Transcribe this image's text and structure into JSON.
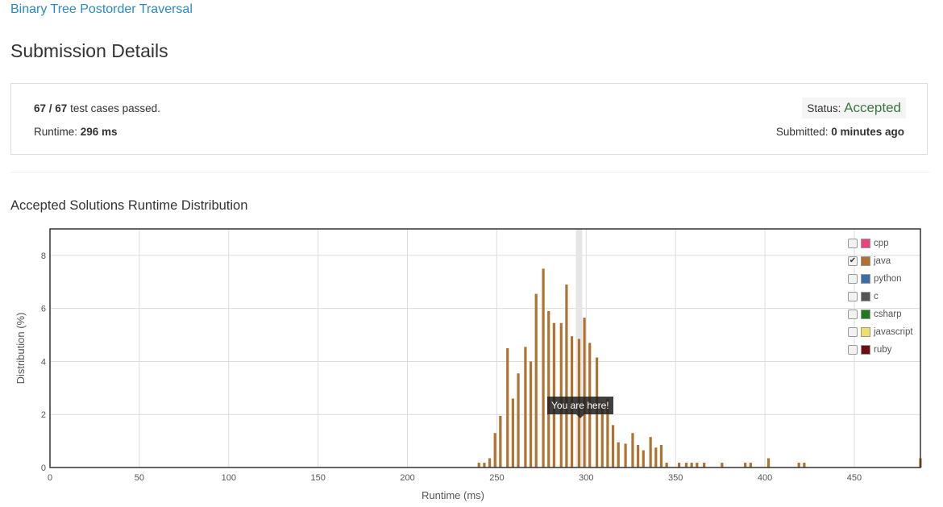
{
  "problem": {
    "title": "Binary Tree Postorder Traversal"
  },
  "page": {
    "title": "Submission Details"
  },
  "details": {
    "passed": "67",
    "sep": " / ",
    "total": "67",
    "passed_suffix": " test cases passed.",
    "runtime_label": "Runtime: ",
    "runtime_value": "296 ms",
    "status_label": "Status: ",
    "status_value": "Accepted",
    "submitted_label": "Submitted: ",
    "submitted_value": "0 minutes ago"
  },
  "colors": {
    "link": "#2a8ac6",
    "accepted": "#3a7a3f",
    "java_bar": "#b07230",
    "highlight": "#e6e6e6"
  },
  "legend": [
    {
      "label": "cpp",
      "color": "#e8457d",
      "checked": false
    },
    {
      "label": "java",
      "color": "#b07230",
      "checked": true
    },
    {
      "label": "python",
      "color": "#3b6da8",
      "checked": false
    },
    {
      "label": "c",
      "color": "#555555",
      "checked": false
    },
    {
      "label": "csharp",
      "color": "#1e7a1e",
      "checked": false
    },
    {
      "label": "javascript",
      "color": "#f0de6a",
      "checked": false
    },
    {
      "label": "ruby",
      "color": "#6b0f0f",
      "checked": false
    }
  ],
  "tooltip": {
    "text": "You are here!"
  },
  "chart_data": {
    "type": "bar",
    "title": "Accepted Solutions Runtime Distribution",
    "xlabel": "Runtime (ms)",
    "ylabel": "Distribution (%)",
    "xlim": [
      0,
      487
    ],
    "ylim": [
      0,
      9
    ],
    "xticks": [
      0,
      50,
      100,
      150,
      200,
      250,
      300,
      350,
      400,
      450
    ],
    "yticks": [
      0,
      2,
      4,
      6,
      8
    ],
    "grid": true,
    "legend_position": "top-right",
    "highlight_x": 296,
    "series": [
      {
        "name": "java",
        "points": [
          [
            240,
            0.18
          ],
          [
            243,
            0.18
          ],
          [
            246,
            0.35
          ],
          [
            249,
            1.3
          ],
          [
            252,
            1.95
          ],
          [
            256,
            4.5
          ],
          [
            259,
            2.6
          ],
          [
            262,
            3.55
          ],
          [
            266,
            4.55
          ],
          [
            269,
            4.0
          ],
          [
            272,
            6.55
          ],
          [
            276,
            7.5
          ],
          [
            279,
            5.9
          ],
          [
            282,
            5.45
          ],
          [
            286,
            5.45
          ],
          [
            289,
            6.9
          ],
          [
            292,
            4.95
          ],
          [
            296,
            4.85
          ],
          [
            299,
            5.65
          ],
          [
            302,
            4.7
          ],
          [
            306,
            4.15
          ],
          [
            309,
            2.45
          ],
          [
            312,
            2.6
          ],
          [
            315,
            1.6
          ],
          [
            318,
            0.95
          ],
          [
            322,
            0.9
          ],
          [
            326,
            1.3
          ],
          [
            329,
            0.85
          ],
          [
            332,
            0.65
          ],
          [
            336,
            1.15
          ],
          [
            339,
            0.75
          ],
          [
            342,
            0.85
          ],
          [
            345,
            0.18
          ],
          [
            352,
            0.18
          ],
          [
            356,
            0.18
          ],
          [
            359,
            0.18
          ],
          [
            362,
            0.18
          ],
          [
            366,
            0.18
          ],
          [
            376,
            0.18
          ],
          [
            389,
            0.18
          ],
          [
            392,
            0.18
          ],
          [
            402,
            0.35
          ],
          [
            419,
            0.18
          ],
          [
            422,
            0.18
          ],
          [
            487,
            0.35
          ]
        ]
      }
    ]
  }
}
